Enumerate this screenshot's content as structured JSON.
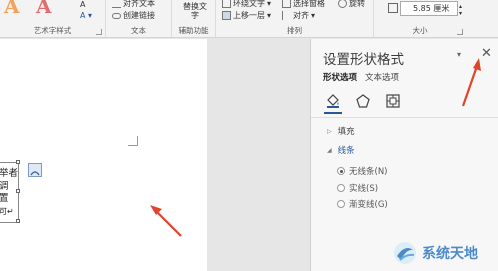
{
  "ribbon": {
    "group_wordart_label": "艺术字样式",
    "group_text_label": "文本",
    "group_text_item1": "对齐文本",
    "group_text_item2": "创建链接",
    "group_accessibility_label": "辅助功能",
    "alt_text_label": "替换文字",
    "group_arrange_label": "排列",
    "wrap_text": "环绕文字",
    "bring_forward": "上移一层",
    "selection_pane": "选择窗格",
    "align": "对齐",
    "rotate": "旋转",
    "group_size_label": "大小",
    "size_value": "5.85 厘米"
  },
  "document": {
    "textbox_lines": [
      "举者",
      "调",
      "置",
      "可↵"
    ]
  },
  "panel": {
    "title": "设置形状格式",
    "menu_glyph": "▾",
    "close_glyph": "✕",
    "tabs": [
      {
        "label": "形状选项",
        "active": true
      },
      {
        "label": "文本选项",
        "active": false
      }
    ],
    "icons": [
      "fill-line-icon",
      "effects-icon",
      "layout-properties-icon"
    ],
    "sections": {
      "fill": "填充",
      "line": "线条"
    },
    "line_options": [
      {
        "label": "无线条(N)",
        "checked": true
      },
      {
        "label": "实线(S)",
        "checked": false
      },
      {
        "label": "渐变线(G)",
        "checked": false
      }
    ]
  },
  "watermark": {
    "text": "系统天地"
  },
  "colors": {
    "accent": "#2b579a",
    "arrow": "#e0442c"
  }
}
